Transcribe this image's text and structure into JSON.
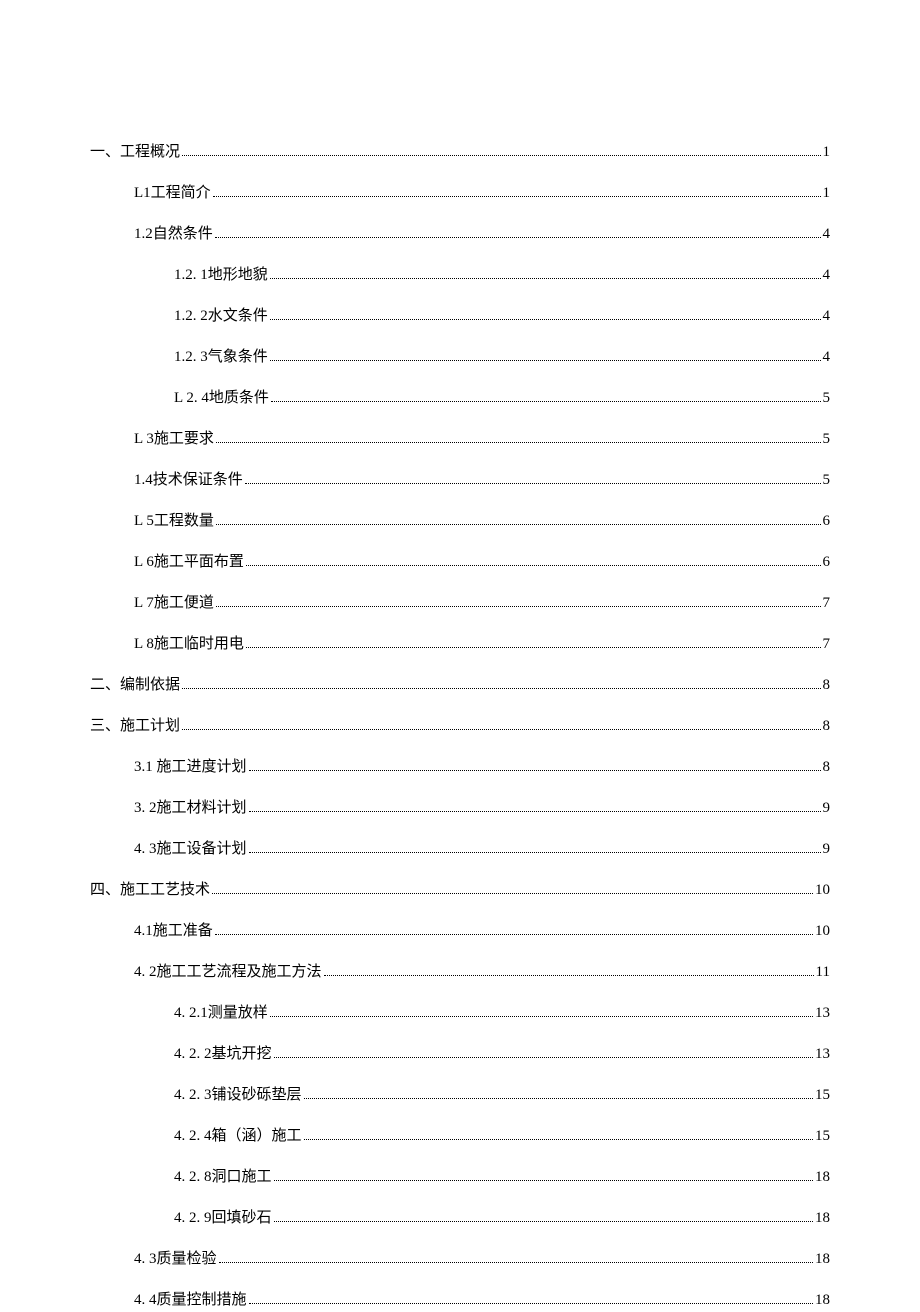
{
  "toc": [
    {
      "label": "一、工程概况",
      "page": "1",
      "indent": 0
    },
    {
      "label": "L1工程简介",
      "page": "1",
      "indent": 1
    },
    {
      "label": "1.2自然条件",
      "page": "4",
      "indent": 1
    },
    {
      "label": "1.2. 1地形地貌",
      "page": "4",
      "indent": 2
    },
    {
      "label": "1.2. 2水文条件",
      "page": "4",
      "indent": 2
    },
    {
      "label": "1.2. 3气象条件",
      "page": "4",
      "indent": 2
    },
    {
      "label": "L 2. 4地质条件",
      "page": "5",
      "indent": 2
    },
    {
      "label": "L 3施工要求",
      "page": "5",
      "indent": 1
    },
    {
      "label": "1.4技术保证条件",
      "page": "5",
      "indent": 1
    },
    {
      "label": "L 5工程数量",
      "page": "6",
      "indent": 1
    },
    {
      "label": "L 6施工平面布置",
      "page": "6",
      "indent": 1
    },
    {
      "label": "L 7施工便道",
      "page": "7",
      "indent": 1
    },
    {
      "label": "L 8施工临时用电",
      "page": "7",
      "indent": 1
    },
    {
      "label": "二、编制依据",
      "page": "8",
      "indent": 0
    },
    {
      "label": "三、施工计划",
      "page": "8",
      "indent": 0
    },
    {
      "label": "3.1  施工进度计划",
      "page": "8",
      "indent": 1
    },
    {
      "label": "3.  2施工材料计划 ",
      "page": "9",
      "indent": 1
    },
    {
      "label": "4.  3施工设备计划 ",
      "page": "9",
      "indent": 1
    },
    {
      "label": "四、施工工艺技术",
      "page": "10",
      "indent": 0
    },
    {
      "label": "4.1施工准备",
      "page": "10",
      "indent": 1
    },
    {
      "label": "4.  2施工工艺流程及施工方法 ",
      "page": " 11",
      "indent": 1
    },
    {
      "label": "4.  2.1测量放样 ",
      "page": "13",
      "indent": 2
    },
    {
      "label": "4.  2. 2基坑开挖",
      "page": "13",
      "indent": 2
    },
    {
      "label": "4.  2. 3铺设砂砾垫层",
      "page": "15",
      "indent": 2
    },
    {
      "label": "4.  2. 4箱（涵）施工 ",
      "page": "15",
      "indent": 2
    },
    {
      "label": "4.  2. 8洞口施工",
      "page": "18",
      "indent": 2
    },
    {
      "label": "4.  2. 9回填砂石",
      "page": "18",
      "indent": 2
    },
    {
      "label": "4.  3质量检验 ",
      "page": "18",
      "indent": 1
    },
    {
      "label": "4.  4质量控制措施 ",
      "page": "18",
      "indent": 1
    }
  ]
}
